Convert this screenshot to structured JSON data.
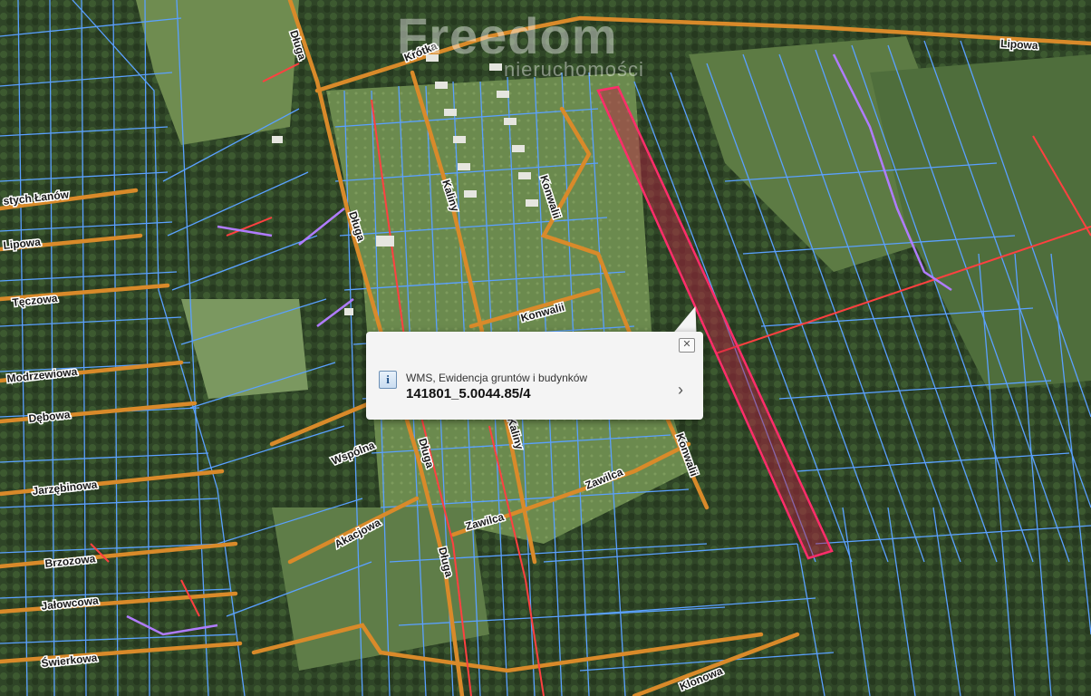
{
  "map": {
    "watermark": {
      "main": "Freedom",
      "sub": "nieruchomości"
    },
    "colors": {
      "parcel_line": "#5aa0ff",
      "road": "#d98a2a",
      "utility": "#ff4040",
      "highlight_fill": "#c21e45",
      "highlight_stroke": "#ff2d6a"
    },
    "street_labels": [
      "Lipowa",
      "Krótka",
      "Długa",
      "Kaliny",
      "Konwalii",
      "Konwalii",
      "Konwalii",
      "Zawilca",
      "Zawilca",
      "Akacjowa",
      "Wspólna",
      "Długa",
      "Długa",
      "Długa",
      "stych Łanów",
      "Lipowa",
      "Tęczowa",
      "Modrzewiowa",
      "Dębowa",
      "Jarzębinowa",
      "Brzozowa",
      "Jałowcowa",
      "Świerkowa",
      "Klonowa",
      "Kaliny"
    ]
  },
  "popup": {
    "source": "WMS, Ewidencja gruntów i budynków",
    "parcel_id": "141801_5.0044.85/4",
    "close_icon": "close-icon",
    "info_icon": "info-icon",
    "chevron_icon": "chevron-right-icon"
  }
}
